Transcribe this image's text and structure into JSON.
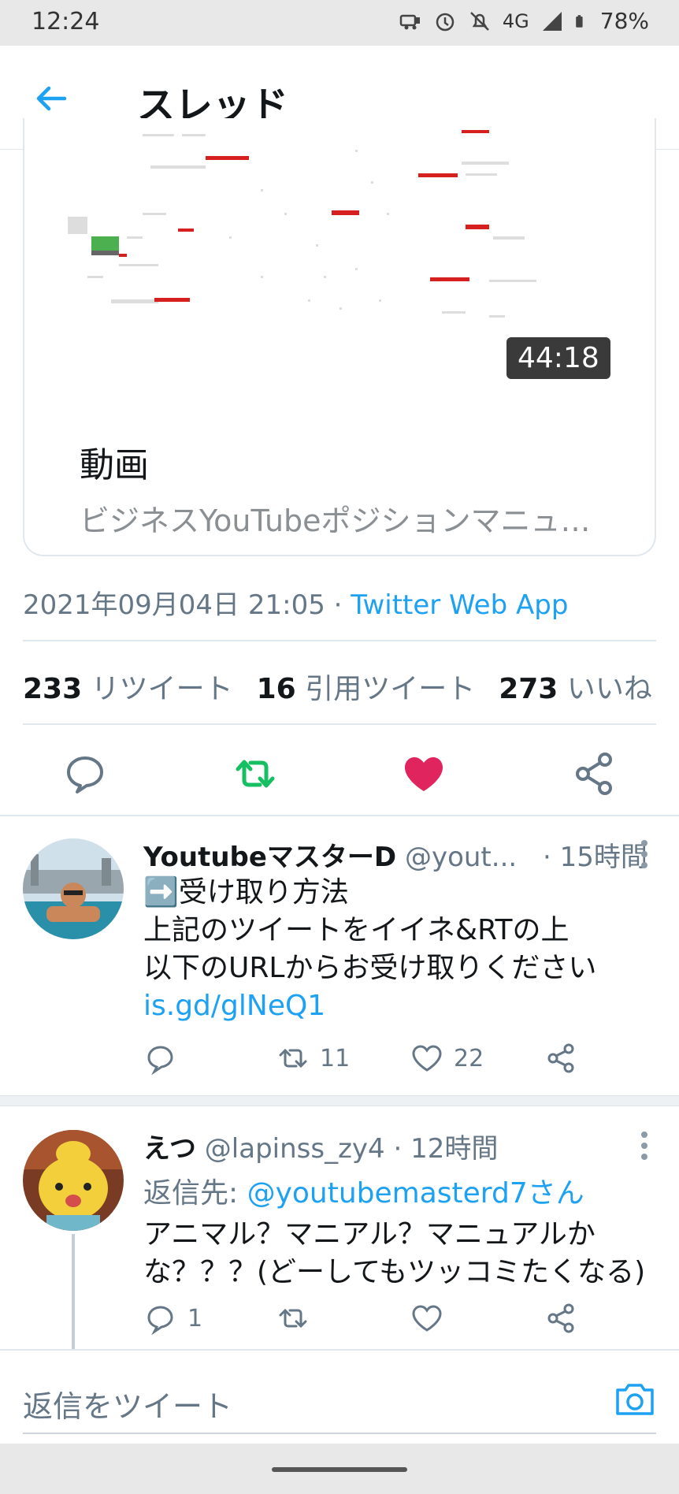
{
  "status_bar": {
    "time": "12:24",
    "network": "4G",
    "battery": "78%",
    "icons": [
      "dashcam-icon",
      "alarm-icon",
      "bell-off-icon",
      "signal-icon",
      "battery-icon"
    ]
  },
  "header": {
    "title": "スレッド",
    "back_icon": "arrow-left-icon"
  },
  "card": {
    "duration": "44:18",
    "title": "動画",
    "description": "ビジネスYouTubeポジションマニュ…"
  },
  "meta": {
    "datetime": "2021年09月04日 21:05",
    "separator": "·",
    "app": "Twitter Web App"
  },
  "stats": {
    "retweets_count": "233",
    "retweets_label": "リツイート",
    "quotes_count": "16",
    "quotes_label": "引用ツイート",
    "likes_count": "273",
    "likes_label": "いいね"
  },
  "colors": {
    "accent": "#1da1f2",
    "retweet_green": "#17bf63",
    "like_red": "#e0245e",
    "muted": "#657786"
  },
  "replies": [
    {
      "name": "YoutubeマスターD",
      "handle": "@yout...",
      "time": "· 15時間",
      "lines": [
        "➡️受け取り方法",
        "上記のツイートをイイネ&RTの上",
        "以下のURLからお受け取りください"
      ],
      "link": "is.gd/glNeQ1",
      "retweets": "11",
      "likes": "22"
    },
    {
      "name": "えつ",
      "handle": "@lapinss_zy4",
      "time": "· 12時間",
      "reply_to_prefix": "返信先: ",
      "reply_to": "@youtubemasterd7さん",
      "lines": [
        "アニマル？マニアル？マニュアルか",
        "な？？？(どーしてもツッコミたくなる)"
      ],
      "comments": "1"
    }
  ],
  "compose": {
    "placeholder": "返信をツイート",
    "camera_icon": "camera-icon"
  }
}
